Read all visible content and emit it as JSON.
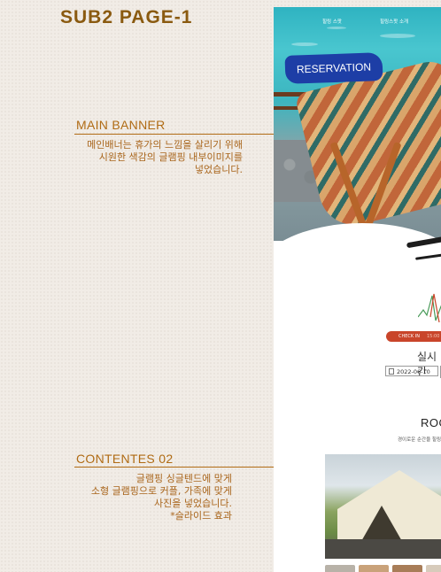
{
  "page_title": "SUB2 PAGE-1",
  "sections": [
    {
      "heading": "MAIN BANNER",
      "description": "메인배너는 휴가의 느낌을 살리기 위해\n시원한 색감의 글램핑 내부이미지를\n넣었습니다."
    },
    {
      "heading": "CONTENTES 02",
      "description": "글램핑 싱글텐드에 맞게\n소형 글램핑으로 커플, 가족에 맞게\n사진을 넣었습니다.\n*슬라이드 효과"
    }
  ],
  "preview": {
    "nav_left": "힐링 스팟",
    "nav_right": "힐링스팟 소개",
    "reservation_label": "RESERVATION",
    "checkin_label": "CHECK IN",
    "checkin_time": "15:00",
    "realtime_label": "실시간",
    "date_value": "2022-06-10",
    "room_title": "ROO",
    "room_subtitle": "경이로운 순간을 힐링"
  },
  "colors": {
    "accent": "#b06b14",
    "title": "#8a5a10",
    "badge": "#1d3ea6",
    "checkin_bar": "#c9452a"
  },
  "icons": {
    "date_picker": "calendar-icon"
  }
}
